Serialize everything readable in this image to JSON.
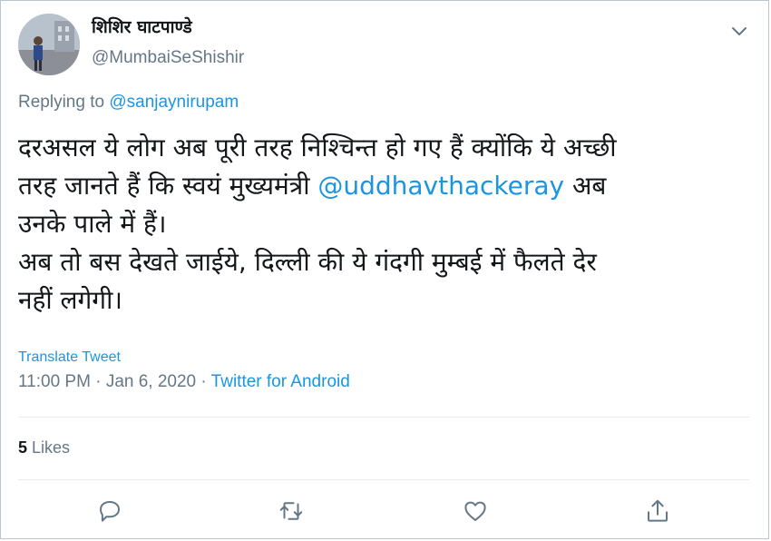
{
  "author": {
    "display_name": "शिशिर घाटपाण्डे",
    "handle": "@MumbaiSeShishir"
  },
  "reply": {
    "prefix": "Replying to ",
    "to": "@sanjaynirupam"
  },
  "tweet": {
    "line1": "दरअसल ये लोग अब पूरी तरह निश्चिन्त हो गए हैं क्योंकि ये अच्छी",
    "line2_prefix": "तरह जानते हैं कि स्वयं मुख्यमंत्री ",
    "mention": "@uddhavthackeray",
    "line2_suffix": " अब",
    "line3": "उनके पाले में हैं।",
    "line4": "अब तो बस देखते जाईये, दिल्ली की ये गंदगी मुम्बई में फैलते देर",
    "line5": "नहीं लगेगी।"
  },
  "translate_label": "Translate Tweet",
  "meta": {
    "time": "11:00 PM",
    "separator1": " · ",
    "date": "Jan 6, 2020",
    "separator2": " · ",
    "source": "Twitter for Android"
  },
  "stats": {
    "likes_count": "5",
    "likes_label": " Likes"
  },
  "colors": {
    "link": "#1b95e0",
    "muted": "#657786",
    "text": "#14171a"
  },
  "icons": {
    "menu": "chevron-down-icon",
    "reply": "reply-icon",
    "retweet": "retweet-icon",
    "like": "heart-icon",
    "share": "share-icon"
  }
}
